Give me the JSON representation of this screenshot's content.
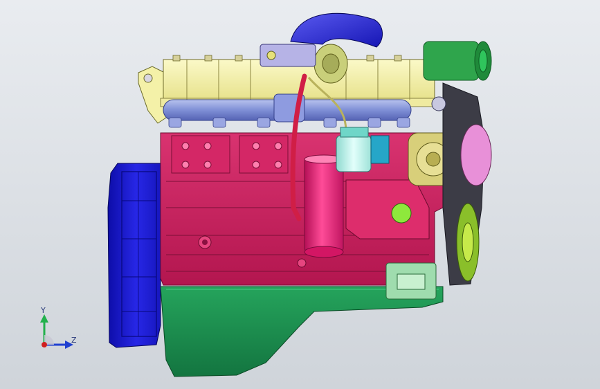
{
  "viewport": {
    "background_top": "#e9ecf0",
    "background_bottom": "#cfd4da"
  },
  "model": {
    "parts": [
      "flywheel-housing",
      "cylinder-head",
      "exhaust-manifold",
      "turbocharger",
      "engine-block",
      "oil-filter",
      "fuel-filter",
      "oil-pan",
      "alternator",
      "ac-compressor",
      "belt-pulleys",
      "lifting-bracket",
      "engine-mount"
    ],
    "colors": {
      "flywheel_housing": "#1a1ad6",
      "cylinder_head": "#f4f1a8",
      "exhaust_manifold": "#7f8fd6",
      "turbocharger": "#2a2ad0",
      "engine_block": "#cc1f5f",
      "oil_pan": "#1a8a4a",
      "oil_filter": "#e0186e",
      "fuel_filter": "#bff2ea",
      "alternator": "#d8cf7a",
      "ac_compressor": "#2fa54c"
    }
  },
  "triad": {
    "y_label": "Y",
    "z_label": "Z",
    "y_color": "#22b14c",
    "z_color": "#2040d0",
    "x_color": "#d02020"
  }
}
